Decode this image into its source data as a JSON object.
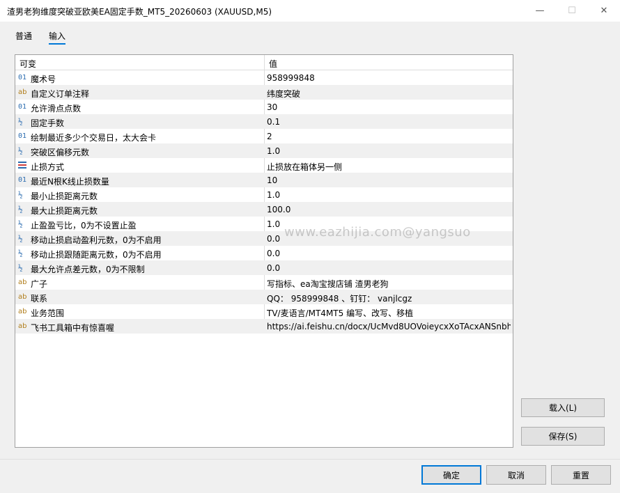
{
  "window": {
    "title": "渣男老狗维度突破亚欧美EA固定手数_MT5_20260603 (XAUUSD,M5)",
    "minimize": "—",
    "maximize": "☐",
    "close": "✕"
  },
  "tabs": [
    {
      "label": "普通",
      "active": false
    },
    {
      "label": "输入",
      "active": true
    }
  ],
  "table": {
    "headers": {
      "name": "可变",
      "value": "值"
    },
    "rows": [
      {
        "icon": "01",
        "type": "int",
        "name": "魔术号",
        "value": "958999848"
      },
      {
        "icon": "ab",
        "type": "string",
        "name": "自定义订单注释",
        "value": "纬度突破"
      },
      {
        "icon": "01",
        "type": "int",
        "name": "允许滑点点数",
        "value": "30"
      },
      {
        "icon": "½",
        "type": "double",
        "name": "固定手数",
        "value": "0.1"
      },
      {
        "icon": "01",
        "type": "int",
        "name": "绘制最近多少个交易日，太大会卡",
        "value": "2"
      },
      {
        "icon": "½",
        "type": "double",
        "name": "突破区偏移元数",
        "value": "1.0"
      },
      {
        "icon": "enum",
        "type": "enum",
        "name": "止损方式",
        "value": "止损放在箱体另一侧"
      },
      {
        "icon": "01",
        "type": "int",
        "name": "最近N根K线止损数量",
        "value": "10"
      },
      {
        "icon": "½",
        "type": "double",
        "name": "最小止损距离元数",
        "value": "1.0"
      },
      {
        "icon": "½",
        "type": "double",
        "name": "最大止损距离元数",
        "value": "100.0"
      },
      {
        "icon": "½",
        "type": "double",
        "name": "止盈盈亏比，0为不设置止盈",
        "value": "1.0"
      },
      {
        "icon": "½",
        "type": "double",
        "name": "移动止损启动盈利元数，0为不启用",
        "value": "0.0"
      },
      {
        "icon": "½",
        "type": "double",
        "name": "移动止损跟随距离元数，0为不启用",
        "value": "0.0"
      },
      {
        "icon": "½",
        "type": "double",
        "name": "最大允许点差元数，0为不限制",
        "value": "0.0"
      },
      {
        "icon": "ab",
        "type": "string",
        "name": "广子",
        "value": "写指标、ea淘宝搜店铺 渣男老狗"
      },
      {
        "icon": "ab",
        "type": "string",
        "name": "联系",
        "value": "QQ：  958999848 、钉钉：  vanjlcgz"
      },
      {
        "icon": "ab",
        "type": "string",
        "name": "业务范围",
        "value": "TV/麦语言/MT4MT5 编写、改写、移植"
      },
      {
        "icon": "ab",
        "type": "string",
        "name": "飞书工具箱中有惊喜喔",
        "value": "https://ai.feishu.cn/docx/UcMvd8UOVoieycxXoTAcxANSnbh"
      }
    ]
  },
  "watermark": "www.eazhijia.com@yangsuo",
  "side_buttons": {
    "load": "载入(L)",
    "save": "保存(S)"
  },
  "footer": {
    "ok": "确定",
    "cancel": "取消",
    "reset": "重置"
  },
  "colors": {
    "accent": "#0078d7",
    "int_icon": "#2b6cb0",
    "string_icon": "#b07d1a"
  }
}
